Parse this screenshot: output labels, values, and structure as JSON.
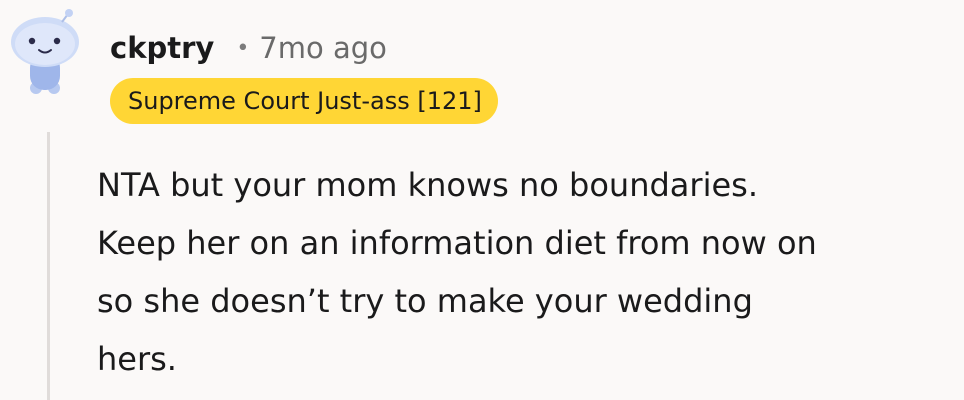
{
  "comment": {
    "username": "ckptry",
    "separator": "•",
    "timestamp": "7mo ago",
    "flair": "Supreme Court Just-ass [121]",
    "flair_color": "#ffd635",
    "body_lines": [
      "NTA but your mom knows no boundaries.",
      "Keep her on an information diet from now on",
      "so she doesn’t try to make your wedding",
      "hers."
    ],
    "avatar_icon": "snoo-avatar-icon"
  }
}
